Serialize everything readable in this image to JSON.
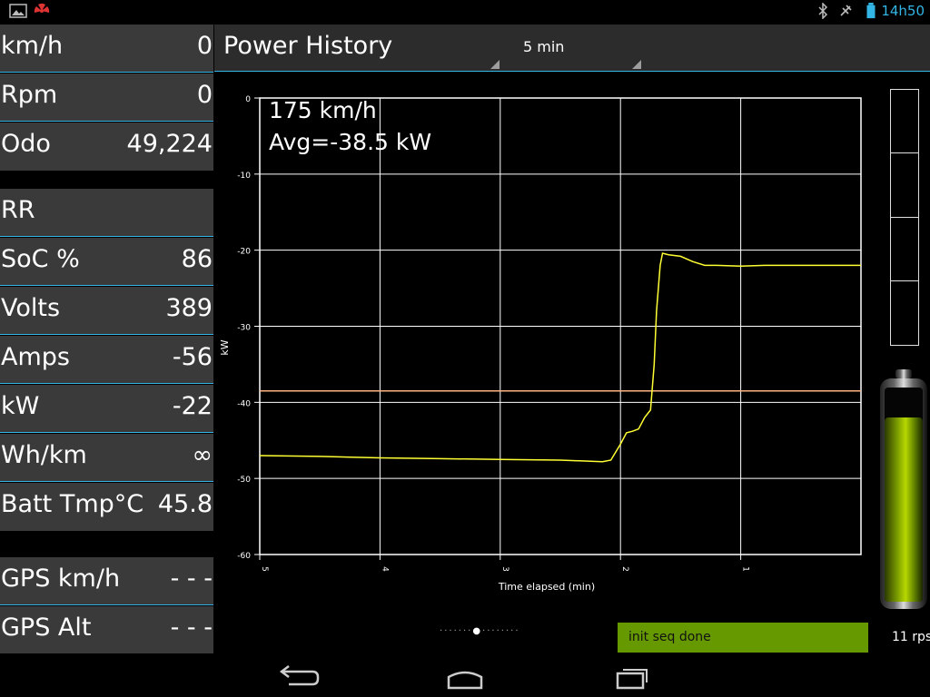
{
  "status_bar": {
    "time": "14h50",
    "left_icons": [
      "image-icon",
      "radiation-icon"
    ],
    "right_icons": [
      "bluetooth-icon",
      "no-gps-icon",
      "battery-icon"
    ]
  },
  "left_panel": {
    "group1": [
      {
        "label": "km/h",
        "value": "0"
      },
      {
        "label": "Rpm",
        "value": "0"
      },
      {
        "label": "Odo",
        "value": "49,224"
      }
    ],
    "group2": [
      {
        "label": "RR",
        "value": ""
      },
      {
        "label": "SoC %",
        "value": "86"
      },
      {
        "label": "Volts",
        "value": "389"
      },
      {
        "label": "Amps",
        "value": "-56"
      },
      {
        "label": "kW",
        "value": "-22"
      },
      {
        "label": "Wh/km",
        "value": "∞"
      },
      {
        "label": "Batt Tmp°C",
        "value": "45.8"
      }
    ],
    "group3": [
      {
        "label": "GPS km/h",
        "value": "- - -"
      },
      {
        "label": "GPS Alt",
        "value": "- - -"
      }
    ]
  },
  "header": {
    "title": "Power History",
    "range": "5 min"
  },
  "chart_overlay": {
    "speed": "175 km/h",
    "avg": "Avg=-38.5 kW"
  },
  "chart_data": {
    "type": "line",
    "xlabel": "Time elapsed (min)",
    "ylabel": "kW",
    "xlim": [
      5,
      0
    ],
    "ylim": [
      -60,
      0
    ],
    "x_ticks": [
      "5",
      "4",
      "3",
      "2",
      "1"
    ],
    "y_ticks": [
      "0",
      "-10",
      "-20",
      "-30",
      "-40",
      "-50",
      "-60"
    ],
    "grid": true,
    "series": [
      {
        "color": "#ffff33",
        "x": [
          5,
          4.5,
          4,
          3.5,
          3,
          2.5,
          2.15,
          2.08,
          2.0,
          1.95,
          1.9,
          1.85,
          1.8,
          1.75,
          1.72,
          1.7,
          1.67,
          1.65,
          1.6,
          1.5,
          1.4,
          1.3,
          1.2,
          1.0,
          0.8,
          0.6,
          0.4,
          0.2,
          0
        ],
        "y": [
          -47,
          -47.1,
          -47.3,
          -47.4,
          -47.5,
          -47.6,
          -47.8,
          -47.6,
          -45.5,
          -44,
          -43.8,
          -43.5,
          -42,
          -41,
          -35,
          -28,
          -22,
          -20.4,
          -20.6,
          -20.8,
          -21.5,
          -22,
          -22,
          -22.1,
          -22,
          -22,
          -22,
          -22,
          -22
        ]
      }
    ],
    "reference_line": {
      "y": -38.5,
      "color": "#ffb380"
    }
  },
  "gauge": {
    "segments": 4
  },
  "battery": {
    "level": 0.86
  },
  "pager": {
    "dots": 16,
    "active": 7
  },
  "status": {
    "message": "init seq done",
    "rps": "11 rps"
  },
  "nav": [
    "back-icon",
    "home-icon",
    "recent-apps-icon"
  ]
}
